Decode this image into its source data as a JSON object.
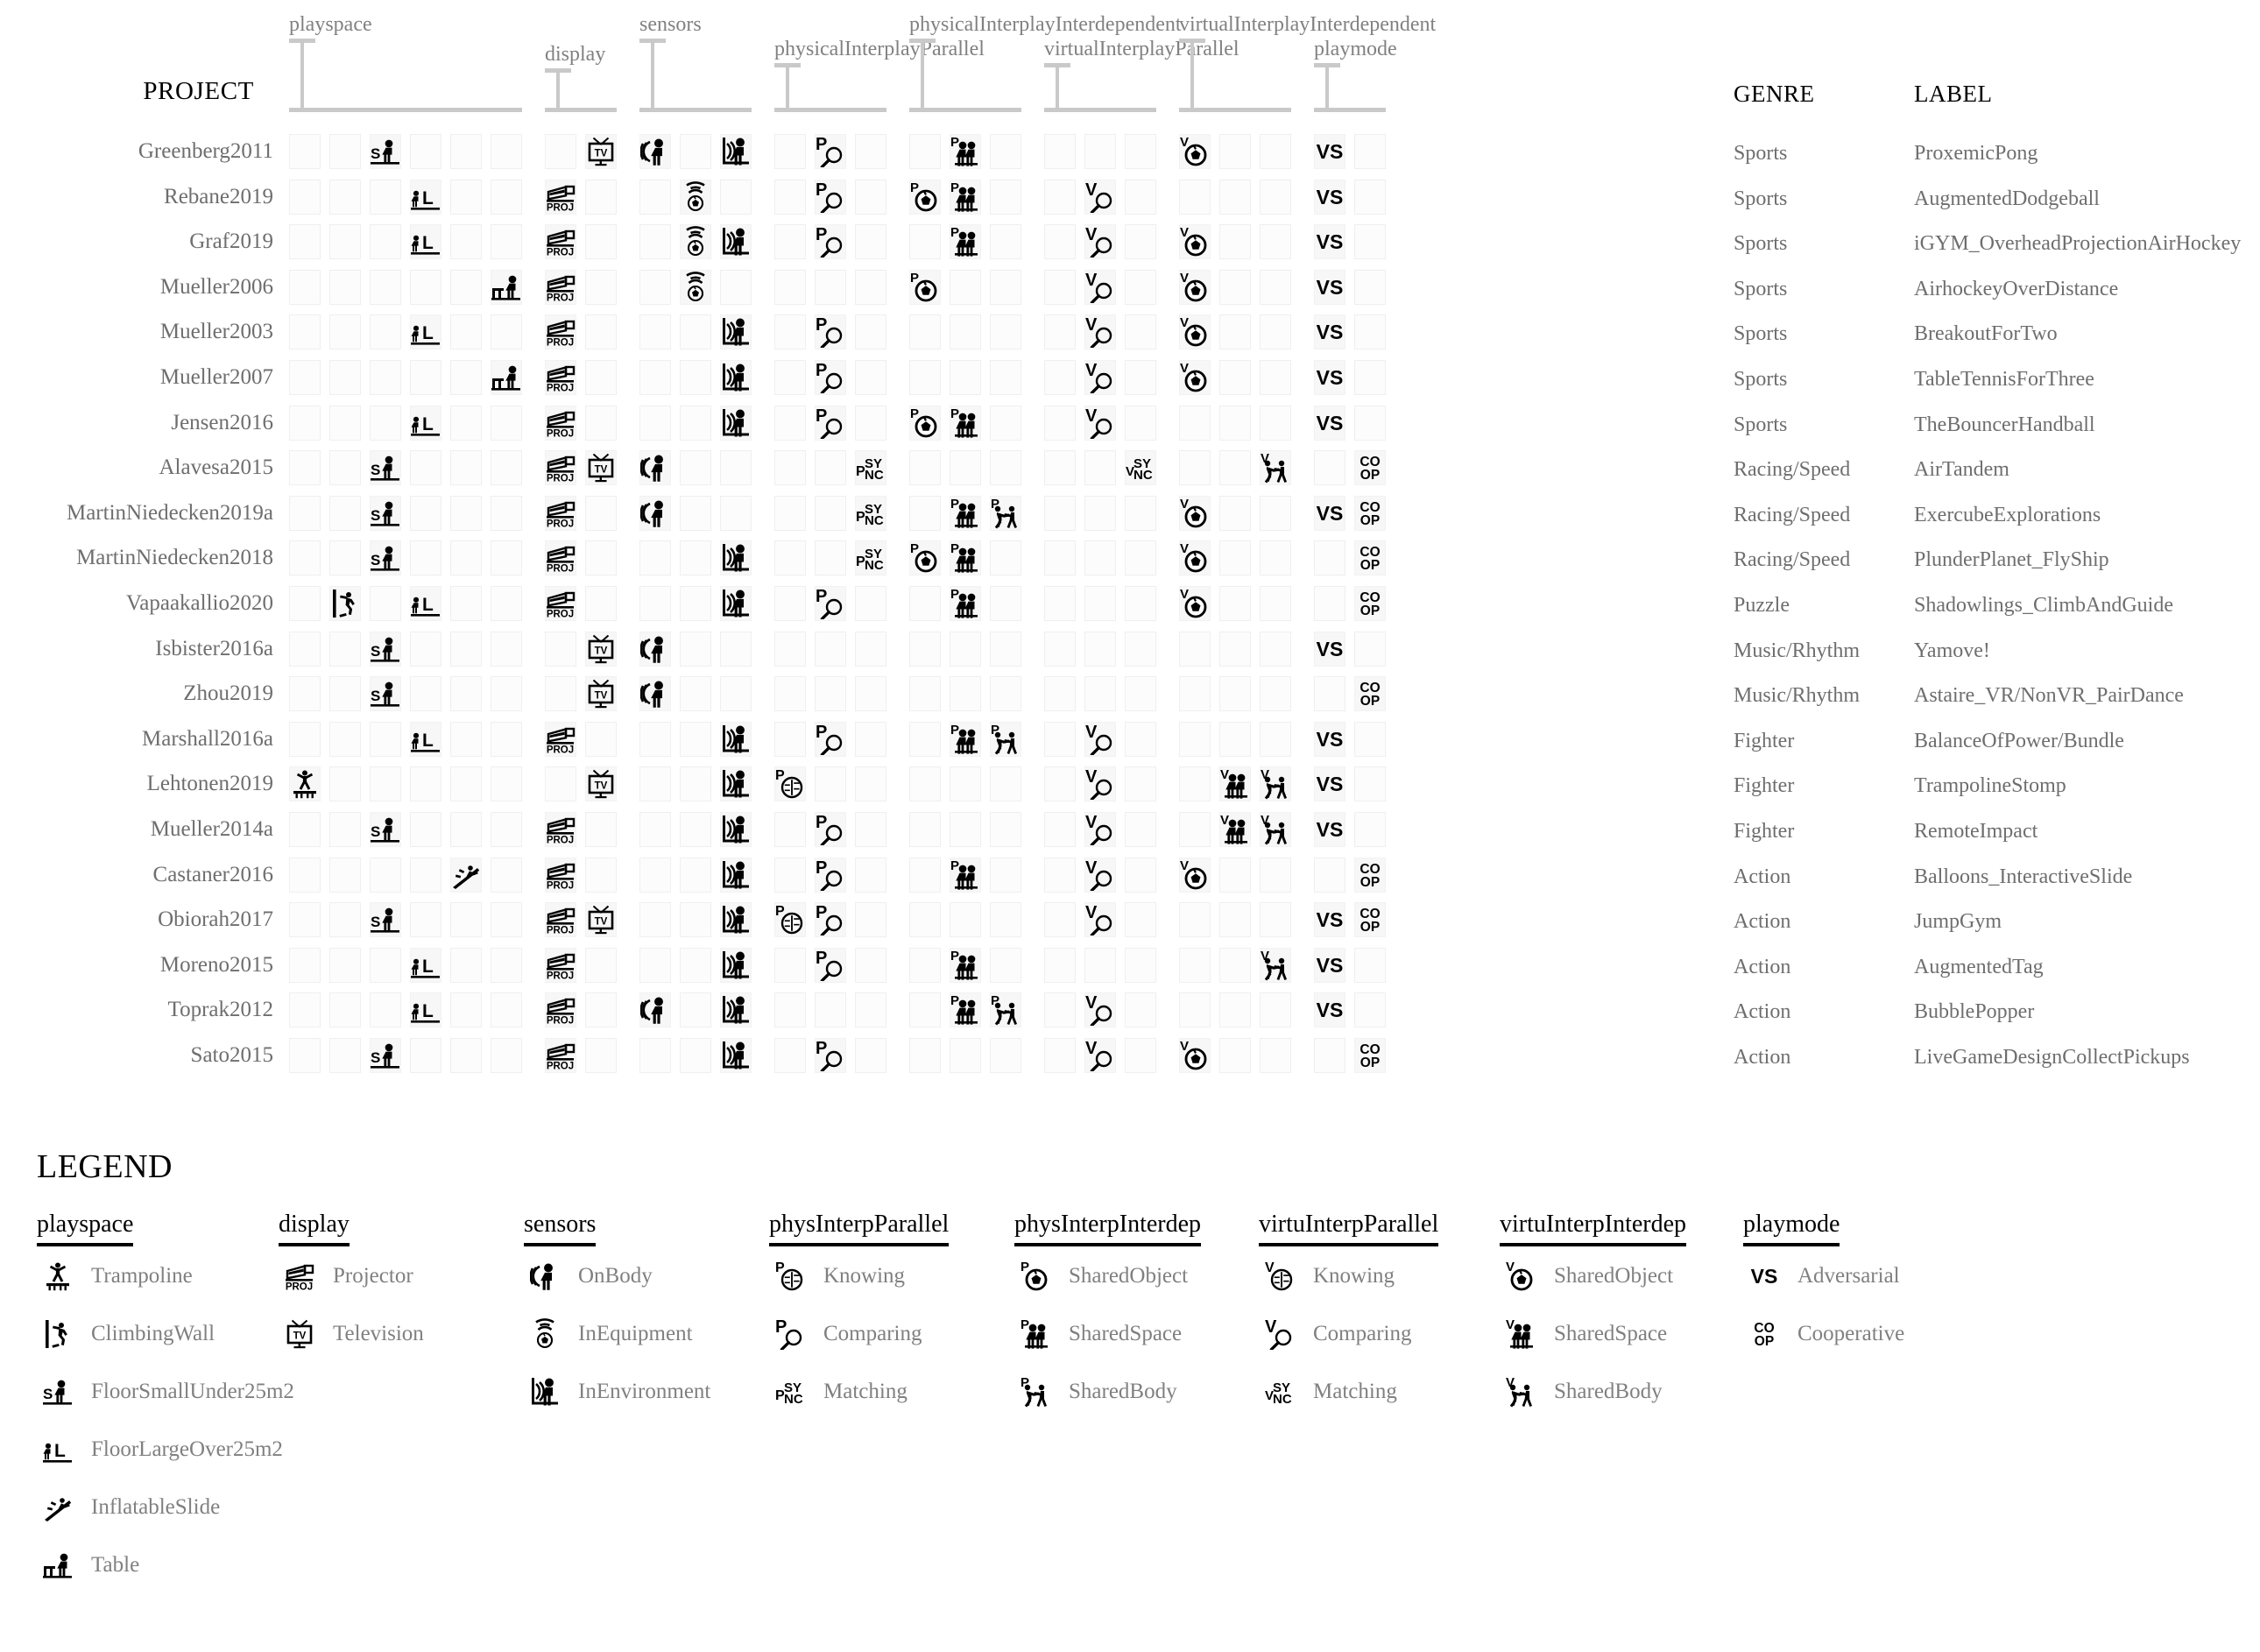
{
  "headers": {
    "project": "PROJECT",
    "genre": "GENRE",
    "label": "LABEL"
  },
  "column_groups": [
    {
      "name": "playspace",
      "label": "playspace",
      "start": 0,
      "span": 6
    },
    {
      "name": "display",
      "label": "display",
      "start": 6,
      "span": 2
    },
    {
      "name": "sensors",
      "label": "sensors",
      "start": 8,
      "span": 3
    },
    {
      "name": "physicalInterplayParallel",
      "label": "physicalInterplayParallel",
      "start": 11,
      "span": 3
    },
    {
      "name": "physicalInterplayInterdependent",
      "label": "physicalInterplayInterdependent",
      "start": 14,
      "span": 3
    },
    {
      "name": "virtualInterplayParallel",
      "label": "virtualInterplayParallel",
      "start": 17,
      "span": 3
    },
    {
      "name": "virtualInterplayInterdependent",
      "label": "virtualInterplayInterdependent",
      "start": 20,
      "span": 3
    },
    {
      "name": "playmode",
      "label": "playmode",
      "start": 23,
      "span": 2
    }
  ],
  "column_icons": [
    "trampoline",
    "climbingwall",
    "floorsmall",
    "floorlarge",
    "inflatableslide",
    "table",
    "projector",
    "television",
    "onbody",
    "inequipment",
    "inenvironment",
    "p-knowing",
    "p-comparing",
    "p-matching",
    "p-sharedobject",
    "p-sharedspace",
    "p-sharedbody",
    "v-knowing",
    "v-comparing",
    "v-matching",
    "v-sharedobject",
    "v-sharedspace",
    "v-sharedbody",
    "vs",
    "coop"
  ],
  "rows": [
    {
      "project": "Greenberg2011",
      "genre": "Sports",
      "label": "ProxemicPong",
      "cells": [
        0,
        0,
        1,
        0,
        0,
        0,
        0,
        1,
        1,
        0,
        1,
        0,
        1,
        0,
        0,
        1,
        0,
        0,
        0,
        0,
        1,
        0,
        0,
        1,
        0
      ]
    },
    {
      "project": "Rebane2019",
      "genre": "Sports",
      "label": "AugmentedDodgeball",
      "cells": [
        0,
        0,
        0,
        1,
        0,
        0,
        1,
        0,
        0,
        1,
        0,
        0,
        1,
        0,
        1,
        1,
        0,
        0,
        1,
        0,
        0,
        0,
        0,
        1,
        0
      ]
    },
    {
      "project": "Graf2019",
      "genre": "Sports",
      "label": "iGYM_OverheadProjectionAirHockey",
      "cells": [
        0,
        0,
        0,
        1,
        0,
        0,
        1,
        0,
        0,
        1,
        1,
        0,
        1,
        0,
        0,
        1,
        0,
        0,
        1,
        0,
        1,
        0,
        0,
        1,
        0
      ]
    },
    {
      "project": "Mueller2006",
      "genre": "Sports",
      "label": "AirhockeyOverDistance",
      "cells": [
        0,
        0,
        0,
        0,
        0,
        1,
        1,
        0,
        0,
        1,
        0,
        0,
        0,
        0,
        1,
        0,
        0,
        0,
        1,
        0,
        1,
        0,
        0,
        1,
        0
      ]
    },
    {
      "project": "Mueller2003",
      "genre": "Sports",
      "label": "BreakoutForTwo",
      "cells": [
        0,
        0,
        0,
        1,
        0,
        0,
        1,
        0,
        0,
        0,
        1,
        0,
        1,
        0,
        0,
        0,
        0,
        0,
        1,
        0,
        1,
        0,
        0,
        1,
        0
      ]
    },
    {
      "project": "Mueller2007",
      "genre": "Sports",
      "label": "TableTennisForThree",
      "cells": [
        0,
        0,
        0,
        0,
        0,
        1,
        1,
        0,
        0,
        0,
        1,
        0,
        1,
        0,
        0,
        0,
        0,
        0,
        1,
        0,
        1,
        0,
        0,
        1,
        0
      ]
    },
    {
      "project": "Jensen2016",
      "genre": "Sports",
      "label": "TheBouncerHandball",
      "cells": [
        0,
        0,
        0,
        1,
        0,
        0,
        1,
        0,
        0,
        0,
        1,
        0,
        1,
        0,
        1,
        1,
        0,
        0,
        1,
        0,
        0,
        0,
        0,
        1,
        0
      ]
    },
    {
      "project": "Alavesa2015",
      "genre": "Racing/Speed",
      "label": "AirTandem",
      "cells": [
        0,
        0,
        1,
        0,
        0,
        0,
        1,
        1,
        1,
        0,
        0,
        0,
        0,
        1,
        0,
        0,
        0,
        0,
        0,
        1,
        0,
        0,
        1,
        0,
        1
      ]
    },
    {
      "project": "MartinNiedecken2019a",
      "genre": "Racing/Speed",
      "label": "ExercubeExplorations",
      "cells": [
        0,
        0,
        1,
        0,
        0,
        0,
        1,
        0,
        1,
        0,
        0,
        0,
        0,
        1,
        0,
        1,
        1,
        0,
        0,
        0,
        1,
        0,
        0,
        1,
        1
      ]
    },
    {
      "project": "MartinNiedecken2018",
      "genre": "Racing/Speed",
      "label": "PlunderPlanet_FlyShip",
      "cells": [
        0,
        0,
        1,
        0,
        0,
        0,
        1,
        0,
        0,
        0,
        1,
        0,
        0,
        1,
        1,
        1,
        0,
        0,
        0,
        0,
        1,
        0,
        0,
        0,
        1
      ]
    },
    {
      "project": "Vapaakallio2020",
      "genre": "Puzzle",
      "label": "Shadowlings_ClimbAndGuide",
      "cells": [
        0,
        1,
        0,
        1,
        0,
        0,
        1,
        0,
        0,
        0,
        1,
        0,
        1,
        0,
        0,
        1,
        0,
        0,
        0,
        0,
        1,
        0,
        0,
        0,
        1
      ]
    },
    {
      "project": "Isbister2016a",
      "genre": "Music/Rhythm",
      "label": "Yamove!",
      "cells": [
        0,
        0,
        1,
        0,
        0,
        0,
        0,
        1,
        1,
        0,
        0,
        0,
        0,
        0,
        0,
        0,
        0,
        0,
        0,
        0,
        0,
        0,
        0,
        1,
        0
      ]
    },
    {
      "project": "Zhou2019",
      "genre": "Music/Rhythm",
      "label": "Astaire_VR/NonVR_PairDance",
      "cells": [
        0,
        0,
        1,
        0,
        0,
        0,
        0,
        1,
        1,
        0,
        0,
        0,
        0,
        0,
        0,
        0,
        0,
        0,
        0,
        0,
        0,
        0,
        0,
        0,
        1
      ]
    },
    {
      "project": "Marshall2016a",
      "genre": "Fighter",
      "label": "BalanceOfPower/Bundle",
      "cells": [
        0,
        0,
        0,
        1,
        0,
        0,
        1,
        0,
        0,
        0,
        1,
        0,
        1,
        0,
        0,
        1,
        1,
        0,
        1,
        0,
        0,
        0,
        0,
        1,
        0
      ]
    },
    {
      "project": "Lehtonen2019",
      "genre": "Fighter",
      "label": "TrampolineStomp",
      "cells": [
        1,
        0,
        0,
        0,
        0,
        0,
        0,
        1,
        0,
        0,
        1,
        1,
        0,
        0,
        0,
        0,
        0,
        0,
        1,
        0,
        0,
        1,
        1,
        1,
        0
      ]
    },
    {
      "project": "Mueller2014a",
      "genre": "Fighter",
      "label": "RemoteImpact",
      "cells": [
        0,
        0,
        1,
        0,
        0,
        0,
        1,
        0,
        0,
        0,
        1,
        0,
        1,
        0,
        0,
        0,
        0,
        0,
        1,
        0,
        0,
        1,
        1,
        1,
        0
      ]
    },
    {
      "project": "Castaner2016",
      "genre": "Action",
      "label": "Balloons_InteractiveSlide",
      "cells": [
        0,
        0,
        0,
        0,
        1,
        0,
        1,
        0,
        0,
        0,
        1,
        0,
        1,
        0,
        0,
        1,
        0,
        0,
        1,
        0,
        1,
        0,
        0,
        0,
        1
      ]
    },
    {
      "project": "Obiorah2017",
      "genre": "Action",
      "label": "JumpGym",
      "cells": [
        0,
        0,
        1,
        0,
        0,
        0,
        1,
        1,
        0,
        0,
        1,
        1,
        1,
        0,
        0,
        0,
        0,
        0,
        1,
        0,
        0,
        0,
        0,
        1,
        1
      ]
    },
    {
      "project": "Moreno2015",
      "genre": "Action",
      "label": "AugmentedTag",
      "cells": [
        0,
        0,
        0,
        1,
        0,
        0,
        1,
        0,
        0,
        0,
        1,
        0,
        1,
        0,
        0,
        1,
        0,
        0,
        0,
        0,
        0,
        0,
        1,
        1,
        0
      ]
    },
    {
      "project": "Toprak2012",
      "genre": "Action",
      "label": "BubblePopper",
      "cells": [
        0,
        0,
        0,
        1,
        0,
        0,
        1,
        0,
        1,
        0,
        1,
        0,
        0,
        0,
        0,
        1,
        1,
        0,
        1,
        0,
        0,
        0,
        0,
        1,
        0
      ]
    },
    {
      "project": "Sato2015",
      "genre": "Action",
      "label": "LiveGameDesignCollectPickups",
      "cells": [
        0,
        0,
        1,
        0,
        0,
        0,
        1,
        0,
        0,
        0,
        1,
        0,
        1,
        0,
        0,
        0,
        0,
        0,
        1,
        0,
        1,
        0,
        0,
        0,
        1
      ]
    }
  ],
  "legend": {
    "title": "LEGEND",
    "columns": [
      {
        "heading": "playspace",
        "items": [
          {
            "icon": "trampoline",
            "text": "Trampoline"
          },
          {
            "icon": "climbingwall",
            "text": "ClimbingWall"
          },
          {
            "icon": "floorsmall",
            "text": "FloorSmallUnder25m2"
          },
          {
            "icon": "floorlarge",
            "text": "FloorLargeOver25m2"
          },
          {
            "icon": "inflatableslide",
            "text": "InflatableSlide"
          },
          {
            "icon": "table",
            "text": "Table"
          }
        ]
      },
      {
        "heading": "display",
        "items": [
          {
            "icon": "projector",
            "text": "Projector"
          },
          {
            "icon": "television",
            "text": "Television"
          }
        ]
      },
      {
        "heading": "sensors",
        "items": [
          {
            "icon": "onbody",
            "text": "OnBody"
          },
          {
            "icon": "inequipment",
            "text": "InEquipment"
          },
          {
            "icon": "inenvironment",
            "text": "InEnvironment"
          }
        ]
      },
      {
        "heading": "physInterpParallel",
        "items": [
          {
            "icon": "p-knowing",
            "text": "Knowing"
          },
          {
            "icon": "p-comparing",
            "text": "Comparing"
          },
          {
            "icon": "p-matching",
            "text": "Matching"
          }
        ]
      },
      {
        "heading": "physInterpInterdep",
        "items": [
          {
            "icon": "p-sharedobject",
            "text": "SharedObject"
          },
          {
            "icon": "p-sharedspace",
            "text": "SharedSpace"
          },
          {
            "icon": "p-sharedbody",
            "text": "SharedBody"
          }
        ]
      },
      {
        "heading": "virtuInterpParallel",
        "items": [
          {
            "icon": "v-knowing",
            "text": "Knowing"
          },
          {
            "icon": "v-comparing",
            "text": "Comparing"
          },
          {
            "icon": "v-matching",
            "text": "Matching"
          }
        ]
      },
      {
        "heading": "virtuInterpInterdep",
        "items": [
          {
            "icon": "v-sharedobject",
            "text": "SharedObject"
          },
          {
            "icon": "v-sharedspace",
            "text": "SharedSpace"
          },
          {
            "icon": "v-sharedbody",
            "text": "SharedBody"
          }
        ]
      },
      {
        "heading": "playmode",
        "items": [
          {
            "icon": "vs",
            "text": "Adversarial"
          },
          {
            "icon": "coop",
            "text": "Cooperative"
          }
        ]
      }
    ]
  },
  "colors": {
    "ink": "#000000",
    "muted_text": "#6e6e6e",
    "group_label": "#818181",
    "cell_border": "#f0f0f0",
    "rule": "#c9c9c9"
  }
}
